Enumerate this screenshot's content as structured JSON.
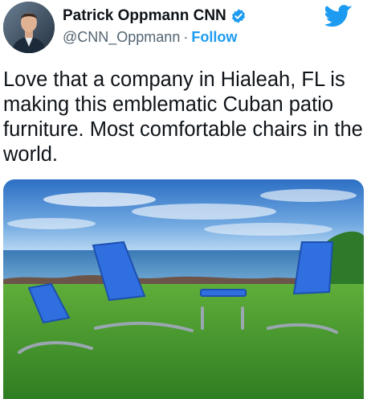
{
  "author": {
    "name": "Patrick Oppmann CNN",
    "handle": "@CNN_Oppmann",
    "separator": "·",
    "follow_label": "Follow"
  },
  "tweet": {
    "text": "Love that a company in Hialeah, FL is making this emblematic Cuban patio furniture. Most comfortable chairs in the world."
  },
  "media": {
    "description_icon": "photo-chairs-on-lawn"
  },
  "colors": {
    "accent": "#1d9bf0",
    "text": "#0f1419",
    "muted": "#536471"
  }
}
